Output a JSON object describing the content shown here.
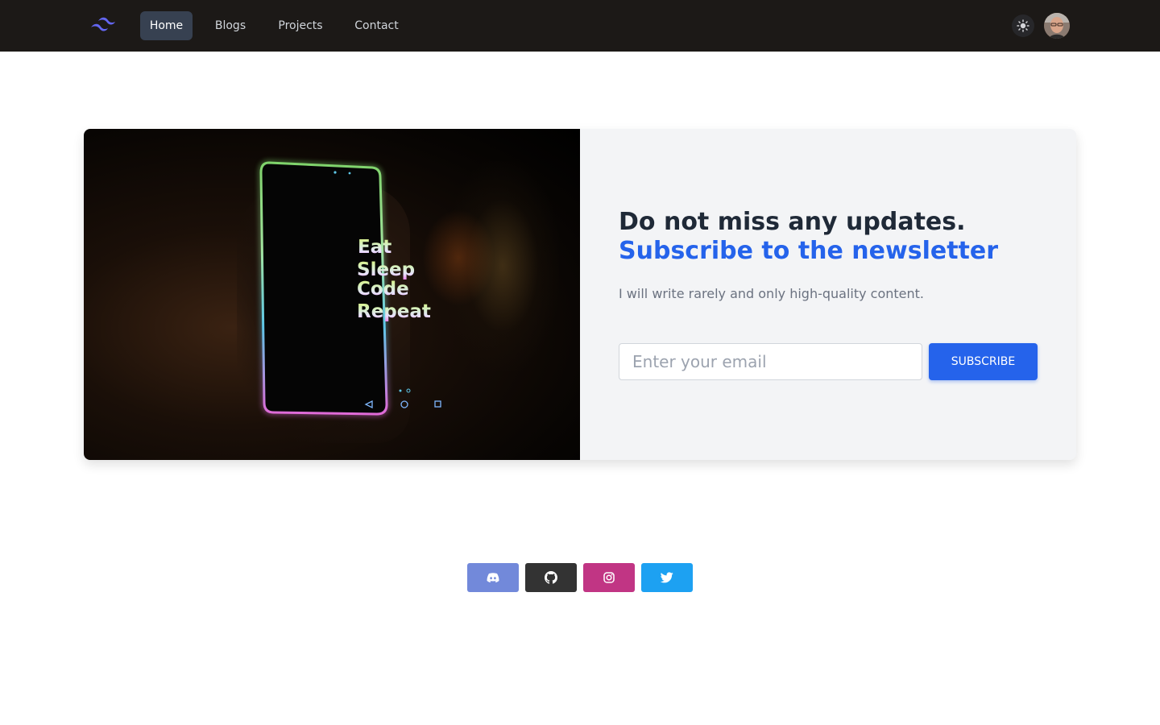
{
  "navbar": {
    "links": [
      {
        "label": "Home",
        "active": true
      },
      {
        "label": "Blogs",
        "active": false
      },
      {
        "label": "Projects",
        "active": false
      },
      {
        "label": "Contact",
        "active": false
      }
    ],
    "logo_icon": "tailwind-wave-logo",
    "theme_icon": "sun-icon",
    "avatar": "user-avatar"
  },
  "hero": {
    "image_alt_icon": "phone-eat-sleep-code-repeat-photo",
    "phone_text": [
      "Eat",
      "Sleep",
      "Code",
      "Repeat"
    ],
    "headline": "Do not miss any updates.",
    "headline_accent": "Subscribe to the newsletter",
    "subtext": "I will write rarely and only high-quality content.",
    "email_placeholder": "Enter your email",
    "email_value": "",
    "subscribe_label": "SUBSCRIBE"
  },
  "social": [
    {
      "name": "discord",
      "icon": "discord-icon",
      "color": "#7289da"
    },
    {
      "name": "github",
      "icon": "github-icon",
      "color": "#333333"
    },
    {
      "name": "instagram",
      "icon": "instagram-icon",
      "color": "#c13584"
    },
    {
      "name": "twitter",
      "icon": "twitter-icon",
      "color": "#1da1f2"
    }
  ],
  "colors": {
    "navbar_bg": "#1c1917",
    "primary": "#2563eb",
    "heading": "#1f2937",
    "muted": "#6b7280",
    "panel_bg": "#f3f4f6"
  }
}
